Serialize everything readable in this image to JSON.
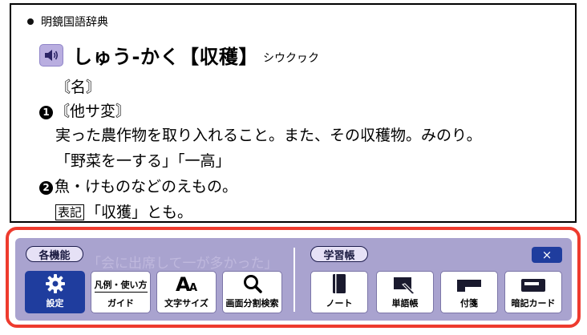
{
  "dictionary": {
    "name": "明鏡国語辞典",
    "headword": "しゅう-かく【収穫】",
    "historical_kana": "シウクヮク",
    "pos": "〘名〙",
    "sense1_number": "1",
    "sense1_category": "〘他サ変〙",
    "sense1_definition": "実った農作物を取り入れること。また、その収穫物。みのり。",
    "sense1_example": "「野菜を一する」「一高」",
    "sense2_number": "2",
    "sense2_definition": "魚・けものなどのえもの。",
    "hyoki_label": "表記",
    "hyoki_text": "「収獲」とも。"
  },
  "toolbar": {
    "ghost_text": "「会に出席して一が多かった」",
    "section_features": "各機能",
    "section_study": "学習帳",
    "close_label": "×",
    "buttons": {
      "settings": "設定",
      "guide_top": "凡例・使い方",
      "guide": "ガイド",
      "font_size": "文字サイズ",
      "image_search": "画面分割検索",
      "note": "ノート",
      "wordbook": "単語帳",
      "sticky": "付箋",
      "flashcard": "暗記カード"
    }
  },
  "icons": [
    "speaker-icon",
    "gear-icon",
    "font-size-icon",
    "magnifier-icon",
    "notebook-icon",
    "wordbook-icon",
    "sticky-note-icon",
    "flashcard-icon",
    "close-icon"
  ],
  "colors": {
    "toolbar_bg": "#a9a3cf",
    "accent_blue": "#1f3d9e",
    "highlight_red": "#ee3b2e"
  }
}
